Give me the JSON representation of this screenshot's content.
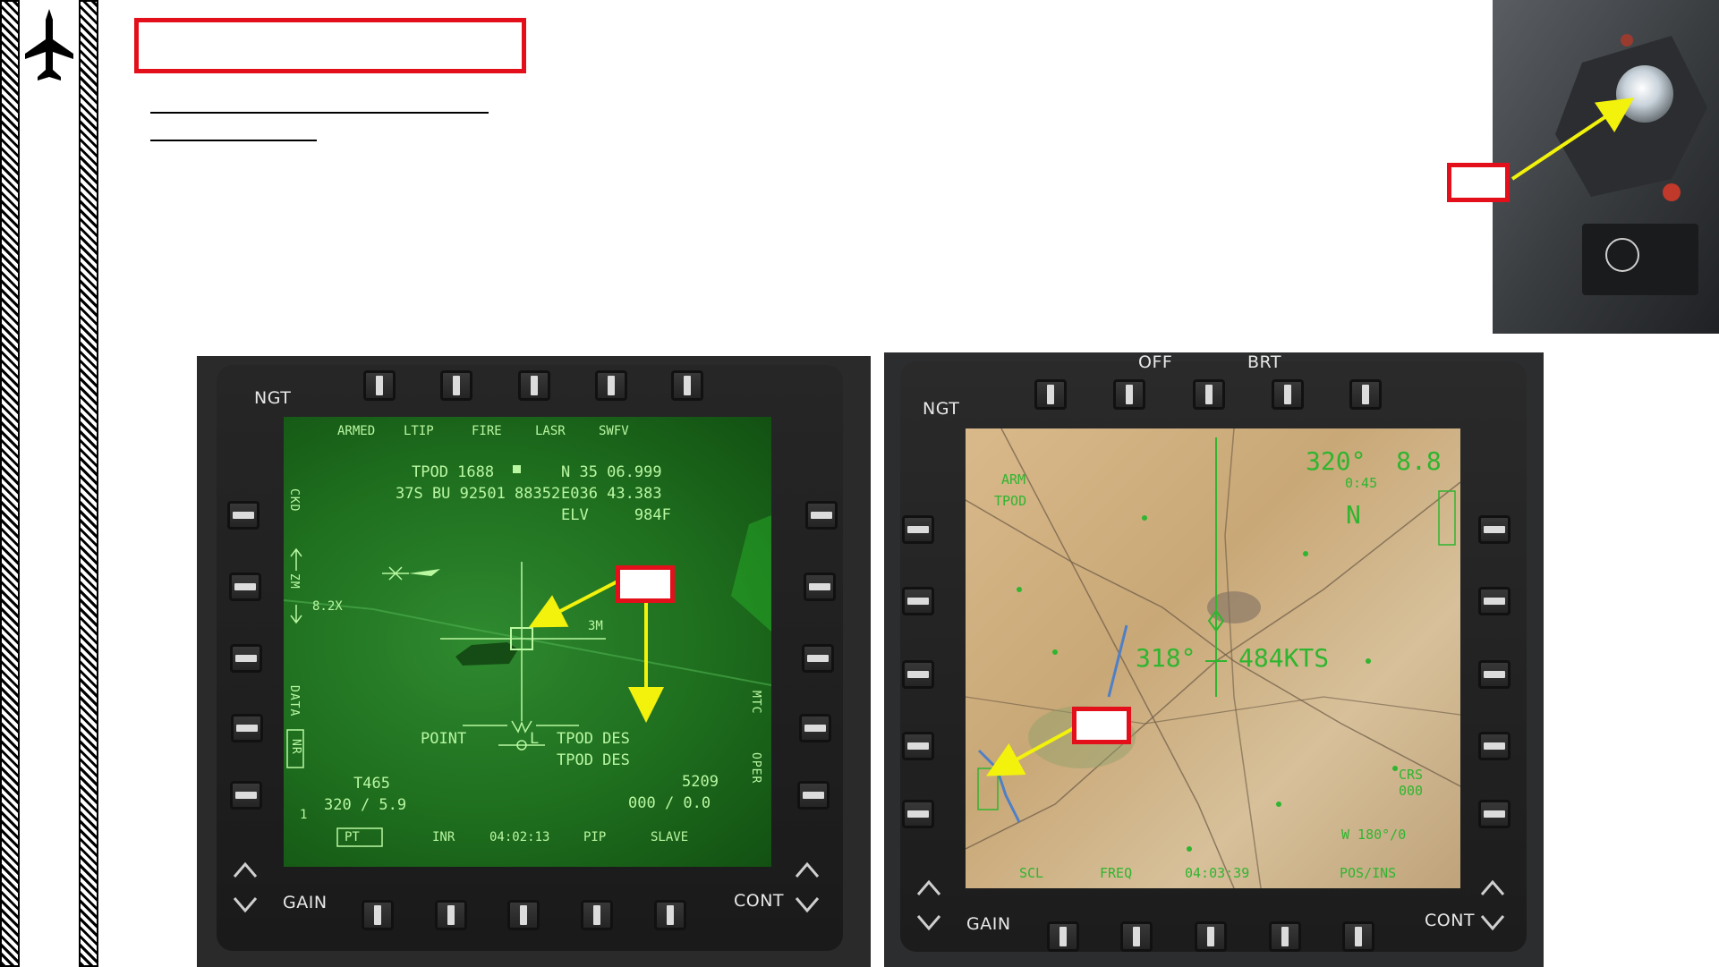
{
  "tpod_display": {
    "ngt_label": "NGT",
    "gain_label": "GAIN",
    "cont_label": "CONT",
    "top_menu": [
      "ARMED",
      "LTIP",
      "FIRE",
      "LASR",
      "SWFV"
    ],
    "bottom_menu": [
      "PT",
      "INR",
      "04:02:13",
      "PIP",
      "SLAVE"
    ],
    "tpod_id": "TPOD 1688",
    "mgrs": "37S BU 92501 88352",
    "lat": "N 35 06.999",
    "lon": "E036 43.383",
    "elv": "ELV     984F",
    "zoom": "8.2X",
    "range": "3M",
    "point_label": "POINT",
    "l_label": "L",
    "tpod_des_1": "TPOD DES",
    "tpod_des_2": "TPOD DES",
    "t_code": "T465",
    "heading_speed": "320 / 5.9",
    "code_5209": "5209",
    "zero_line": "000 / 0.0",
    "left_labels": {
      "ckd": "CKD",
      "zm": "ZM",
      "data": "DATA",
      "nr": "NR",
      "one": "1"
    },
    "right_labels": {
      "mtc": "MTC",
      "oper": "OPER"
    }
  },
  "map_display": {
    "ngt_label": "NGT",
    "gain_label": "GAIN",
    "cont_label": "CONT",
    "off_label": "OFF",
    "brt_label": "BRT",
    "arm": "ARM",
    "tpod": "TPOD",
    "heading": "318°",
    "speed": "484KTS",
    "n_mark": "N",
    "top_right": "320°  8.8",
    "top_right_2": "0:45",
    "bottom_items": [
      "SCL",
      "FREQ",
      "04:03:39",
      "POS/INS"
    ],
    "bottom_right": "W 180°/0",
    "crs": "CRS",
    "crs_val": "000"
  },
  "colors": {
    "callout_red": "#e3101b",
    "arrow_yellow": "#f2f20c",
    "tpod_green": "#1e6e1e",
    "symbology_green": "#b9f7a1"
  }
}
